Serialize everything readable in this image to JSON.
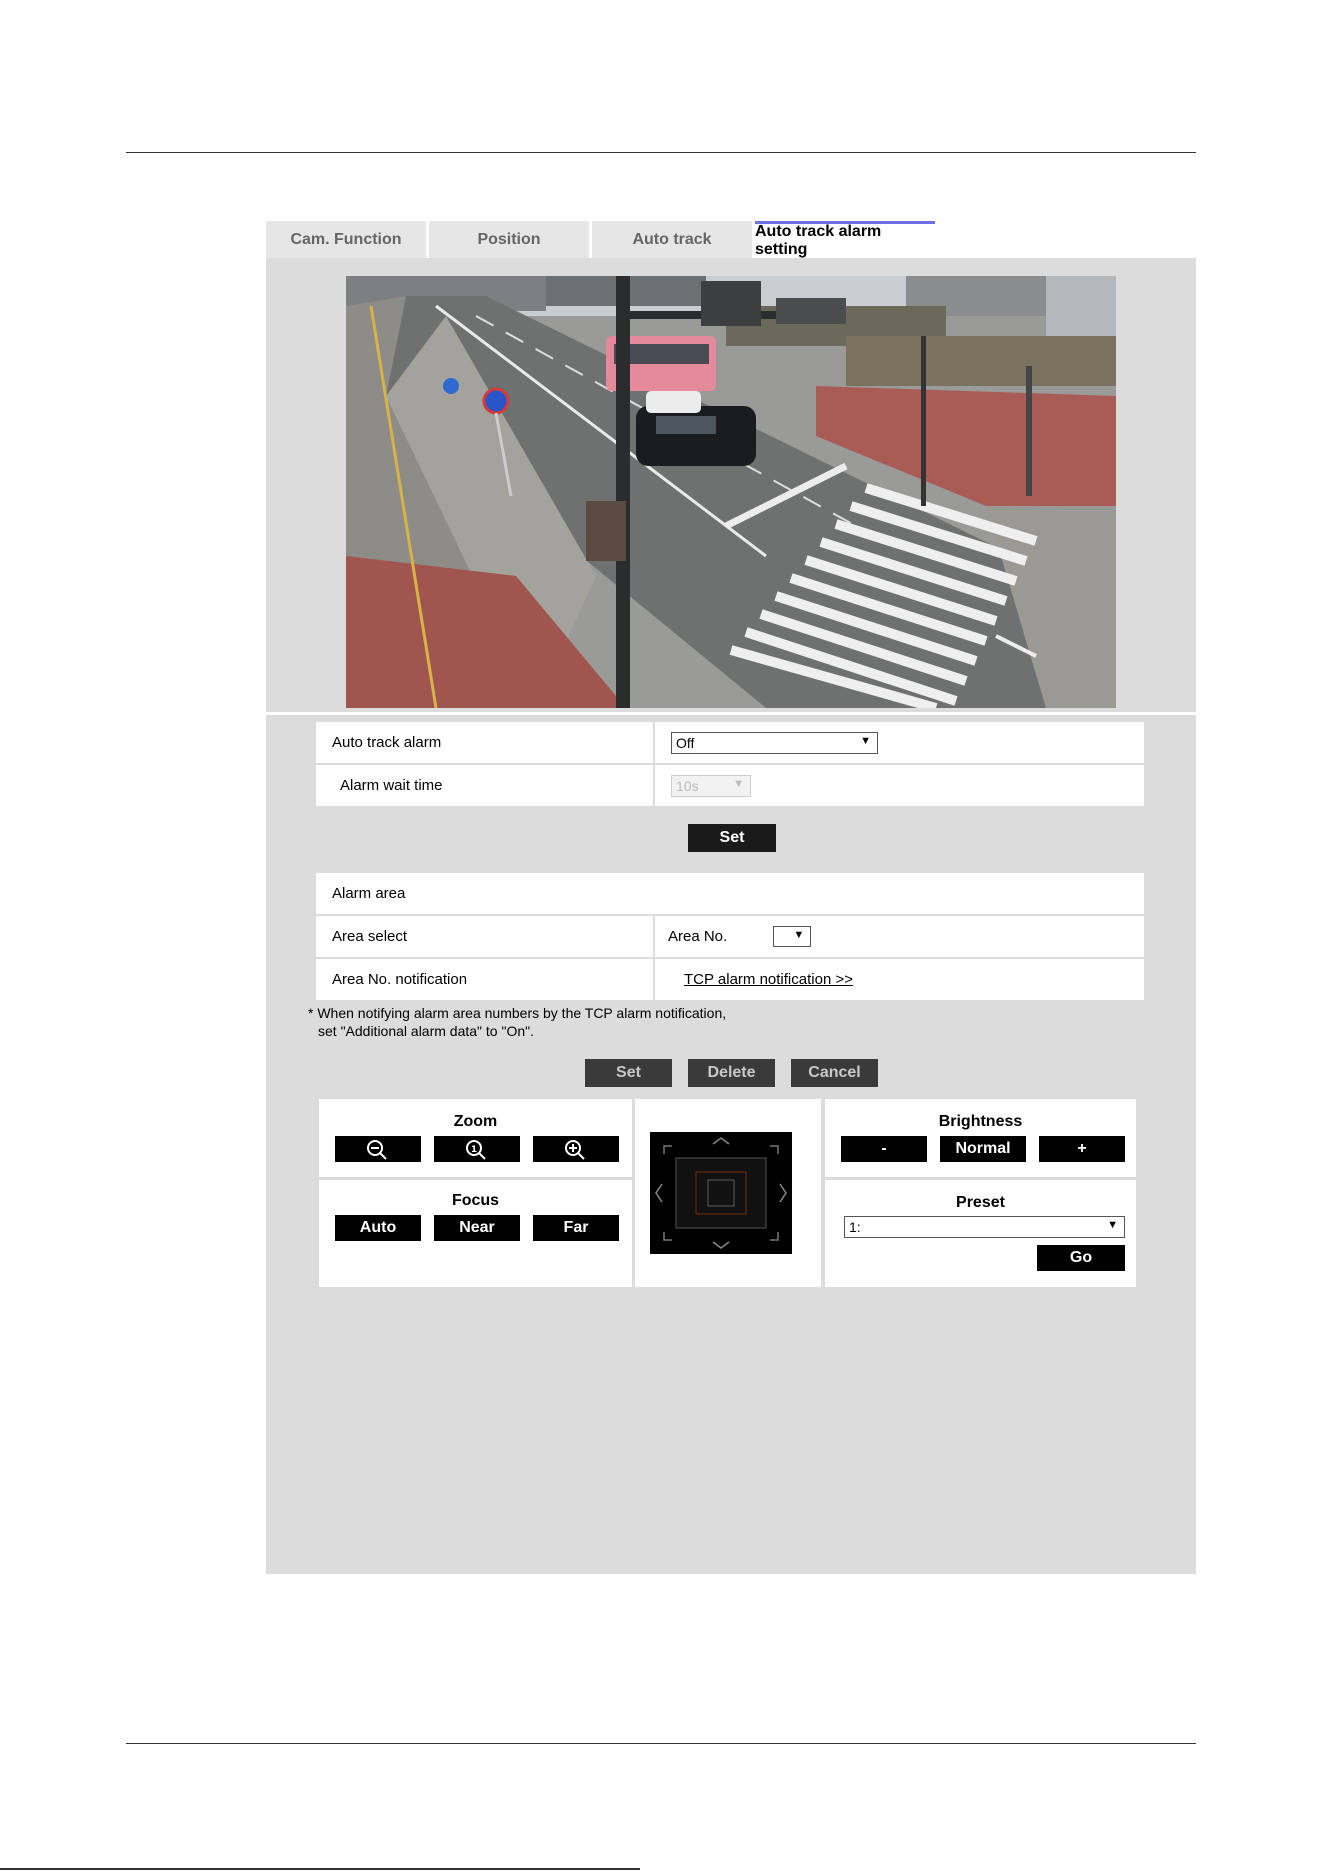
{
  "tabs": [
    {
      "label": "Cam. Function"
    },
    {
      "label": "Position"
    },
    {
      "label": "Auto track"
    },
    {
      "label": "Auto track alarm setting"
    }
  ],
  "settings": {
    "auto_track_alarm": {
      "label": "Auto track alarm",
      "value": "Off"
    },
    "alarm_wait_time": {
      "label": "Alarm wait time",
      "value": "10s"
    },
    "set_label": "Set"
  },
  "alarm_area": {
    "heading": "Alarm area",
    "area_select": {
      "label": "Area select",
      "prefix": "Area No.",
      "value": ""
    },
    "notification": {
      "label": "Area No. notification",
      "link": "TCP alarm notification >>"
    },
    "note_line1": "* When notifying alarm area numbers by the TCP alarm notification,",
    "note_line2": "set \"Additional alarm data\" to \"On\".",
    "buttons": {
      "set": "Set",
      "delete": "Delete",
      "cancel": "Cancel"
    }
  },
  "controls": {
    "zoom": {
      "title": "Zoom"
    },
    "focus": {
      "title": "Focus",
      "auto": "Auto",
      "near": "Near",
      "far": "Far"
    },
    "brightness": {
      "title": "Brightness",
      "minus": "-",
      "normal": "Normal",
      "plus": "+"
    },
    "preset": {
      "title": "Preset",
      "value": "1:",
      "go": "Go"
    }
  }
}
